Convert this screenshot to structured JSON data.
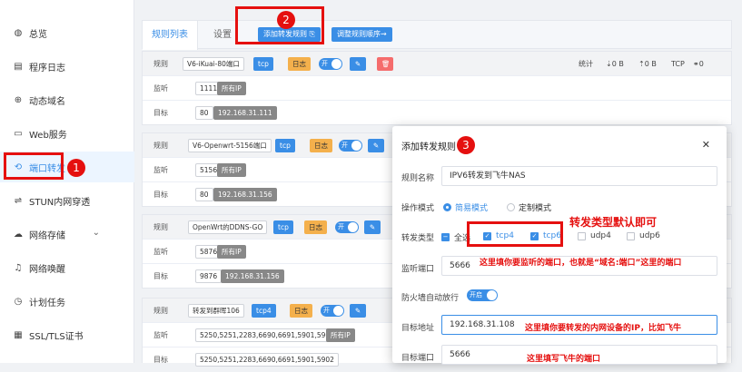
{
  "sidebar": {
    "items": [
      {
        "label": "总览",
        "icon": "dashboard-icon"
      },
      {
        "label": "程序日志",
        "icon": "log-icon"
      },
      {
        "label": "动态域名",
        "icon": "globe-icon"
      },
      {
        "label": "Web服务",
        "icon": "web-icon"
      },
      {
        "label": "端口转发",
        "icon": "port-forward-icon"
      },
      {
        "label": "STUN内网穿透",
        "icon": "stun-icon"
      },
      {
        "label": "网络存储",
        "icon": "cloud-icon"
      },
      {
        "label": "网络唤醒",
        "icon": "bell-icon"
      },
      {
        "label": "计划任务",
        "icon": "clock-icon"
      },
      {
        "label": "SSL/TLS证书",
        "icon": "cert-icon"
      }
    ]
  },
  "tabs": {
    "rules": "规则列表",
    "settings": "设置"
  },
  "toolbar": {
    "add_rule": "添加转发规则 ⎘",
    "adjust_order": "调整规则顺序⇝"
  },
  "badges": {
    "b1": "1",
    "b2": "2",
    "b3": "3"
  },
  "rules": [
    {
      "rule": "V6-iKuai-80端口",
      "proto": "tcp",
      "log": "日志",
      "toggle": "开",
      "listen_port": "1111",
      "listen_ip": "所有IP",
      "target_port": "80",
      "target_ip": "192.168.31.111"
    },
    {
      "rule": "V6-Openwrt-5156端口",
      "proto": "tcp",
      "log": "日志",
      "toggle": "开",
      "listen_port": "5156",
      "listen_ip": "所有IP",
      "target_port": "80",
      "target_ip": "192.168.31.156"
    },
    {
      "rule": "OpenWrt的DDNS-GO",
      "proto": "tcp",
      "log": "日志",
      "toggle": "开",
      "listen_port": "5876",
      "listen_ip": "所有IP",
      "target_port": "9876",
      "target_ip": "192.168.31.156"
    },
    {
      "rule": "转发到群晖106",
      "proto": "tcp4",
      "log": "日志",
      "toggle": "开",
      "listen_port": "5250,5251,2283,6690,6691,5901,5902",
      "listen_ip": "所有IP",
      "target_port": "5250,5251,2283,6690,6691,5901,5902",
      "target_ip": ""
    }
  ],
  "row_labels": {
    "rule": "规则",
    "listen": "监听",
    "target": "目标"
  },
  "stats": {
    "label": "统计",
    "down": "⇣0 B",
    "up": "⇡0 B",
    "tcp": "TCP",
    "link": "⚭0"
  },
  "modal": {
    "title": "添加转发规则",
    "close": "✕",
    "name_label": "规则名称",
    "name_value": "IPV6转发到飞牛NAS",
    "mode_label": "操作模式",
    "mode_simple": "简易模式",
    "mode_custom": "定制模式",
    "type_label": "转发类型",
    "type_all": "全选",
    "type_tcp4": "tcp4",
    "type_tcp6": "tcp6",
    "type_udp4": "udp4",
    "type_udp6": "udp6",
    "listen_label": "监听端口",
    "listen_value": "5666",
    "firewall_label": "防火墙自动放行",
    "firewall_toggle": "开启",
    "target_addr_label": "目标地址",
    "target_addr_value": "192.168.31.108",
    "target_port_label": "目标端口",
    "target_port_value": "5666"
  },
  "annotations": {
    "type_note": "转发类型默认即可",
    "listen_note": "这里填你要监听的端口，也就是“域名:端口”这里的端口",
    "target_note": "这里填你要转发的内网设备的IP，比如飞牛",
    "port_note": "这里填写飞牛的端口"
  }
}
